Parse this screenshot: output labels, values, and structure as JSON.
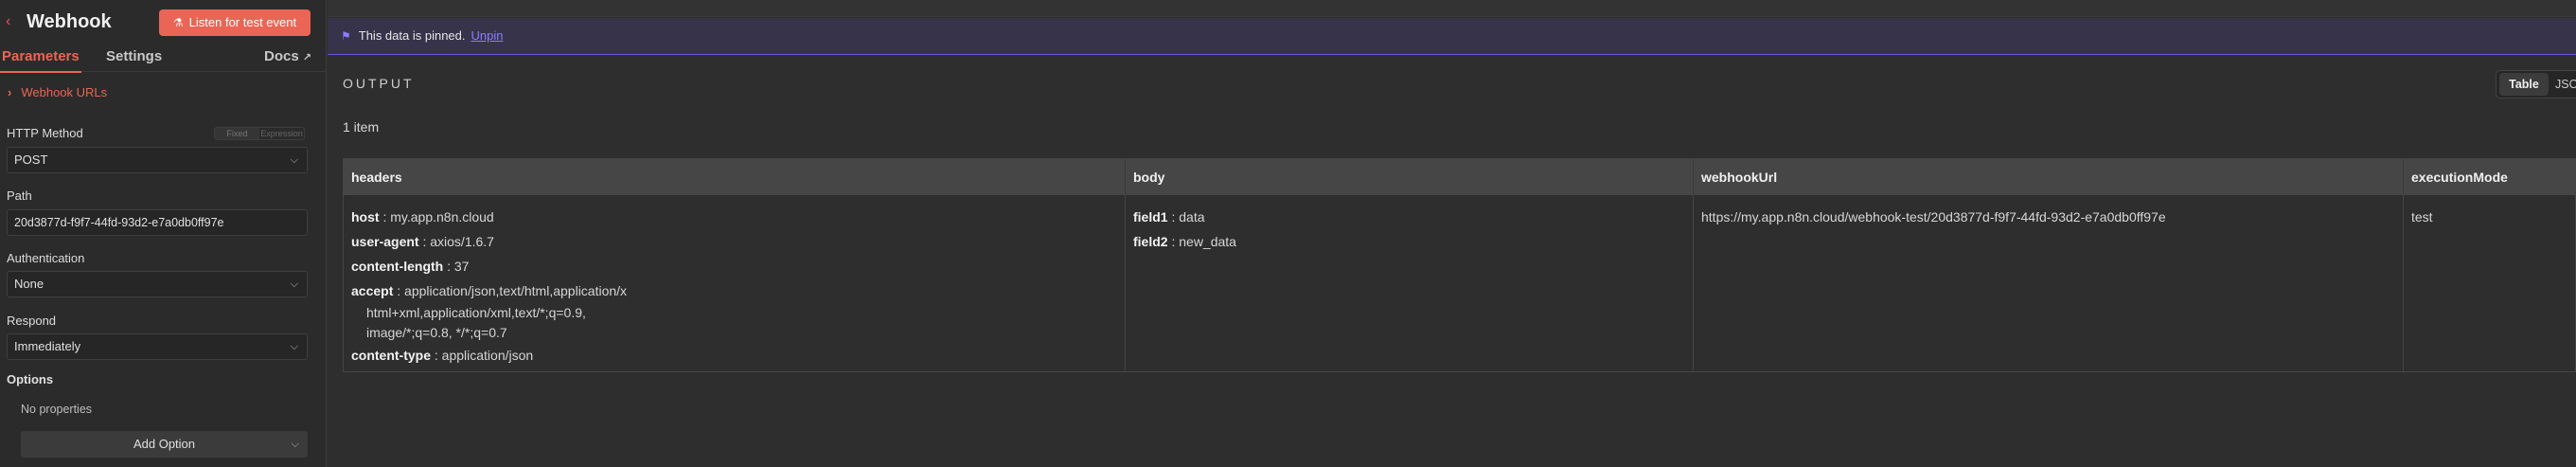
{
  "node": {
    "title": "Webhook",
    "listen_button": "Listen for test event"
  },
  "tabs": {
    "parameters": "Parameters",
    "settings": "Settings",
    "docs": "Docs"
  },
  "webhook_urls_link": "Webhook URLs",
  "fields": {
    "http_method": {
      "label": "HTTP Method",
      "value": "POST",
      "toggle": [
        "Fixed",
        "Expression"
      ]
    },
    "path": {
      "label": "Path",
      "value": "20d3877d-f9f7-44fd-93d2-e7a0db0ff97e"
    },
    "authentication": {
      "label": "Authentication",
      "value": "None"
    },
    "respond": {
      "label": "Respond",
      "value": "Immediately"
    }
  },
  "options": {
    "label": "Options",
    "empty_text": "No properties",
    "add_button": "Add Option"
  },
  "pinned": {
    "message": "This data is pinned.",
    "unpin_label": "Unpin"
  },
  "output": {
    "title": "OUTPUT",
    "item_count": "1 item",
    "views": [
      "Table",
      "JSON"
    ]
  },
  "table": {
    "columns": [
      "headers",
      "body",
      "webhookUrl",
      "executionMode"
    ],
    "headers": [
      {
        "key": "host",
        "value": "my.app.n8n.cloud"
      },
      {
        "key": "user-agent",
        "value": "axios/1.6.7"
      },
      {
        "key": "content-length",
        "value": "37"
      },
      {
        "key": "accept",
        "value": "application/json,text/html,application/x",
        "wrap": [
          "html+xml,application/xml,text/*;q=0.9,",
          "image/*;q=0.8, */*;q=0.7"
        ]
      },
      {
        "key": "content-type",
        "value": "application/json"
      }
    ],
    "body": [
      {
        "key": "field1",
        "value": "data"
      },
      {
        "key": "field2",
        "value": "new_data"
      }
    ],
    "webhookUrl": "https://my.app.n8n.cloud/webhook-test/20d3877d-f9f7-44fd-93d2-e7a0db0ff97e",
    "executionMode": "test"
  }
}
